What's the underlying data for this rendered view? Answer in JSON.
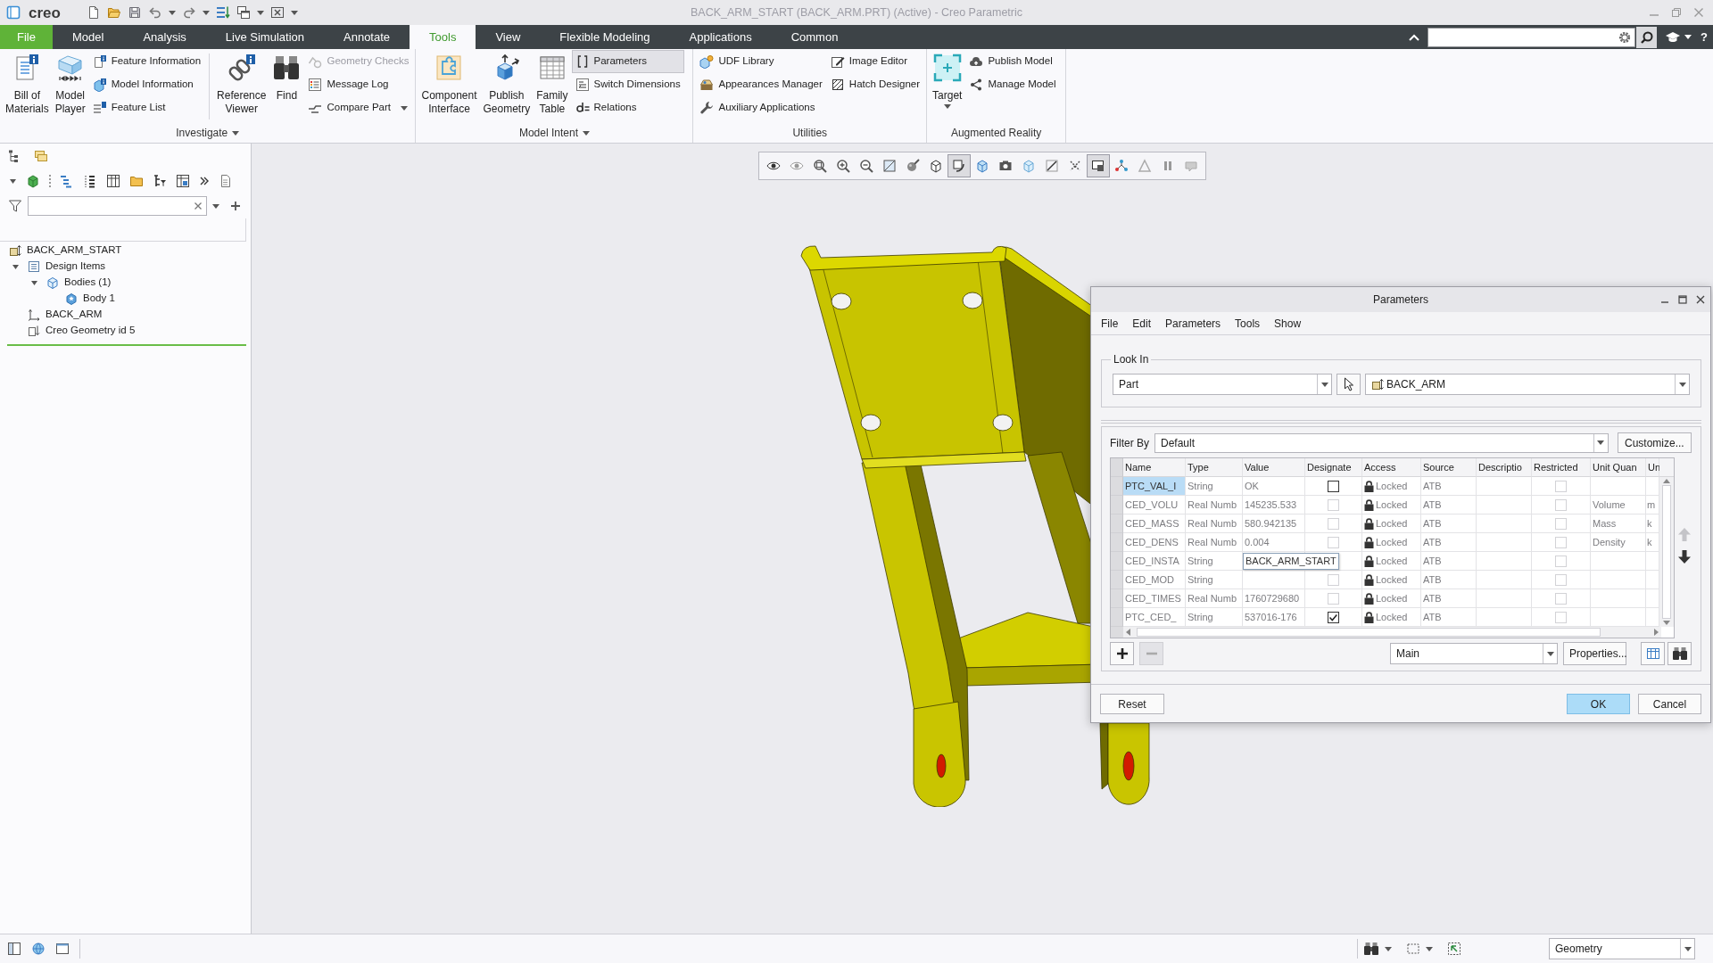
{
  "window": {
    "logo": "creo",
    "title": "BACK_ARM_START (BACK_ARM.PRT) (Active) - Creo Parametric"
  },
  "ribbon_tabs": [
    {
      "label": "File",
      "kind": "menu",
      "selected": false
    },
    {
      "label": "Model",
      "kind": "tab",
      "selected": false
    },
    {
      "label": "Analysis",
      "kind": "tab",
      "selected": false
    },
    {
      "label": "Live Simulation",
      "kind": "tab",
      "selected": false
    },
    {
      "label": "Annotate",
      "kind": "tab",
      "selected": false
    },
    {
      "label": "Tools",
      "kind": "tab",
      "selected": true
    },
    {
      "label": "View",
      "kind": "tab",
      "selected": false
    },
    {
      "label": "Flexible Modeling",
      "kind": "tab",
      "selected": false
    },
    {
      "label": "Applications",
      "kind": "tab",
      "selected": false
    },
    {
      "label": "Common",
      "kind": "tab",
      "selected": false
    }
  ],
  "help_button": "?",
  "ribbon_groups": [
    {
      "label": "Investigate",
      "menu": true,
      "blocks": [
        {
          "kind": "large",
          "label": "Bill of\nMaterials",
          "disabled": false,
          "active": false,
          "menu": false
        },
        {
          "kind": "large",
          "label": "Model\nPlayer",
          "disabled": false,
          "active": false,
          "menu": false
        },
        {
          "kind": "stack",
          "items": [
            {
              "label": "Feature Information",
              "disabled": false,
              "active": false,
              "menu": false
            },
            {
              "label": "Model Information",
              "disabled": false,
              "active": false,
              "menu": false
            },
            {
              "label": "Feature List",
              "disabled": false,
              "active": false,
              "menu": false
            }
          ]
        },
        {
          "kind": "separator"
        },
        {
          "kind": "large",
          "label": "Reference\nViewer",
          "disabled": false,
          "active": false,
          "menu": false
        },
        {
          "kind": "large",
          "label": "Find",
          "disabled": false,
          "active": false,
          "menu": false
        },
        {
          "kind": "stack",
          "items": [
            {
              "label": "Geometry Checks",
              "disabled": true,
              "active": false,
              "menu": false
            },
            {
              "label": "Message Log",
              "disabled": false,
              "active": false,
              "menu": false
            },
            {
              "label": "Compare Part",
              "disabled": false,
              "active": false,
              "menu": true
            }
          ]
        }
      ]
    },
    {
      "label": "Model Intent",
      "menu": true,
      "blocks": [
        {
          "kind": "large",
          "label": "Component\nInterface",
          "disabled": false,
          "active": false,
          "menu": false
        },
        {
          "kind": "large",
          "label": "Publish\nGeometry",
          "disabled": false,
          "active": false,
          "menu": false
        },
        {
          "kind": "large",
          "label": "Family\nTable",
          "disabled": false,
          "active": false,
          "menu": false
        },
        {
          "kind": "stack",
          "items": [
            {
              "label": "Parameters",
              "disabled": false,
              "active": true,
              "menu": false
            },
            {
              "label": "Switch Dimensions",
              "disabled": false,
              "active": false,
              "menu": false
            },
            {
              "label": "Relations",
              "disabled": false,
              "active": false,
              "menu": false
            }
          ]
        }
      ]
    },
    {
      "label": "Utilities",
      "menu": false,
      "blocks": [
        {
          "kind": "stack",
          "items": [
            {
              "label": "UDF Library",
              "disabled": false,
              "active": false,
              "menu": false
            },
            {
              "label": "Appearances Manager",
              "disabled": false,
              "active": false,
              "menu": false
            },
            {
              "label": "Auxiliary Applications",
              "disabled": false,
              "active": false,
              "menu": false
            }
          ]
        },
        {
          "kind": "stack",
          "items": [
            {
              "label": "Image Editor",
              "disabled": false,
              "active": false,
              "menu": false
            },
            {
              "label": "Hatch Designer",
              "disabled": false,
              "active": false,
              "menu": false
            }
          ]
        }
      ]
    },
    {
      "label": "Augmented Reality",
      "menu": false,
      "blocks": [
        {
          "kind": "large",
          "label": "Target",
          "disabled": false,
          "active": false,
          "menu": true
        },
        {
          "kind": "stack",
          "items": [
            {
              "label": "Publish Model",
              "disabled": false,
              "active": false,
              "menu": false
            },
            {
              "label": "Manage Model",
              "disabled": false,
              "active": false,
              "menu": false
            }
          ]
        }
      ]
    }
  ],
  "model_tree": [
    {
      "label": "BACK_ARM_START",
      "kind": "part",
      "children": [
        {
          "label": "Design Items",
          "kind": "design-items",
          "expanded": true,
          "children": [
            {
              "label": "Bodies (1)",
              "kind": "bodies",
              "expanded": true,
              "children": [
                {
                  "label": "Body 1",
                  "kind": "body"
                }
              ]
            }
          ]
        },
        {
          "label": "BACK_ARM",
          "kind": "csys"
        },
        {
          "label": "Creo Geometry id 5",
          "kind": "geometry"
        }
      ]
    }
  ],
  "view_toolbar": [
    {
      "on": false
    },
    {
      "on": false
    },
    {
      "on": false
    },
    {
      "on": false
    },
    {
      "on": false
    },
    {
      "on": false
    },
    {
      "on": false
    },
    {
      "on": false
    },
    {
      "on": true
    },
    {
      "on": false
    },
    {
      "on": false
    },
    {
      "on": false
    },
    {
      "on": false
    },
    {
      "on": false
    },
    {
      "on": true
    },
    {
      "on": false
    },
    {
      "on": false
    },
    {
      "on": false
    },
    {
      "on": false
    }
  ],
  "parameters_dialog": {
    "title": "Parameters",
    "menu": [
      "File",
      "Edit",
      "Parameters",
      "Tools",
      "Show"
    ],
    "look_in": {
      "label": "Look In",
      "scope": "Part",
      "object": "BACK_ARM"
    },
    "filter": {
      "label": "Filter By",
      "value": "Default"
    },
    "customize_button": "Customize...",
    "columns": [
      "Name",
      "Type",
      "Value",
      "Designate",
      "Access",
      "Source",
      "Descriptio",
      "Restricted",
      "Unit Quan",
      "Un"
    ],
    "rows": [
      {
        "selected": true,
        "editing": false,
        "name": "PTC_VAL_I",
        "type": "String",
        "value": "OK",
        "designate": {
          "checked": false,
          "disabled": false
        },
        "access": "Locked",
        "source": "ATB",
        "restricted": {
          "checked": false,
          "disabled": true
        }
      },
      {
        "selected": false,
        "editing": false,
        "name": "CED_VOLU",
        "type": "Real Numb",
        "value": "145235.533",
        "designate": {
          "checked": false,
          "disabled": true
        },
        "access": "Locked",
        "source": "ATB",
        "restricted": {
          "checked": false,
          "disabled": true
        },
        "unit_quantity": "Volume",
        "column_10": "m"
      },
      {
        "selected": false,
        "editing": false,
        "name": "CED_MASS",
        "type": "Real Numb",
        "value": "580.942135",
        "designate": {
          "checked": false,
          "disabled": true
        },
        "access": "Locked",
        "source": "ATB",
        "restricted": {
          "checked": false,
          "disabled": true
        },
        "unit_quantity": "Mass",
        "column_10": "k"
      },
      {
        "selected": false,
        "editing": false,
        "name": "CED_DENS",
        "type": "Real Numb",
        "value": "0.004",
        "designate": {
          "checked": false,
          "disabled": true
        },
        "access": "Locked",
        "source": "ATB",
        "restricted": {
          "checked": false,
          "disabled": true
        },
        "unit_quantity": "Density",
        "column_10": "k"
      },
      {
        "selected": false,
        "editing": true,
        "name": "CED_INSTA",
        "type": "String",
        "value": "BACK_ARM_START",
        "access": "Locked",
        "source": "ATB",
        "restricted": {
          "checked": false,
          "disabled": true
        }
      },
      {
        "selected": false,
        "editing": false,
        "name": "CED_MOD",
        "type": "String",
        "designate": {
          "checked": false,
          "disabled": true
        },
        "access": "Locked",
        "source": "ATB",
        "restricted": {
          "checked": false,
          "disabled": true
        }
      },
      {
        "selected": false,
        "editing": false,
        "name": "CED_TIMES",
        "type": "Real Numb",
        "value": "1760729680",
        "designate": {
          "checked": false,
          "disabled": true
        },
        "access": "Locked",
        "source": "ATB",
        "restricted": {
          "checked": false,
          "disabled": true
        }
      },
      {
        "selected": false,
        "editing": false,
        "name": "PTC_CED_",
        "type": "String",
        "value": "537016-176",
        "designate": {
          "checked": true,
          "disabled": false
        },
        "access": "Locked",
        "source": "ATB",
        "restricted": {
          "checked": false,
          "disabled": true
        }
      }
    ],
    "move_buttons": [
      {
        "disabled": true
      },
      {
        "disabled": false
      }
    ],
    "add_button": {
      "disabled": false
    },
    "remove_button": {
      "disabled": true
    },
    "view": "Main",
    "properties_button": "Properties...",
    "reset_button": "Reset",
    "buttons": [
      {
        "label": "OK",
        "default": true
      },
      {
        "label": "Cancel",
        "default": false
      }
    ]
  },
  "status_bar": {
    "selection_filter": "Geometry"
  }
}
